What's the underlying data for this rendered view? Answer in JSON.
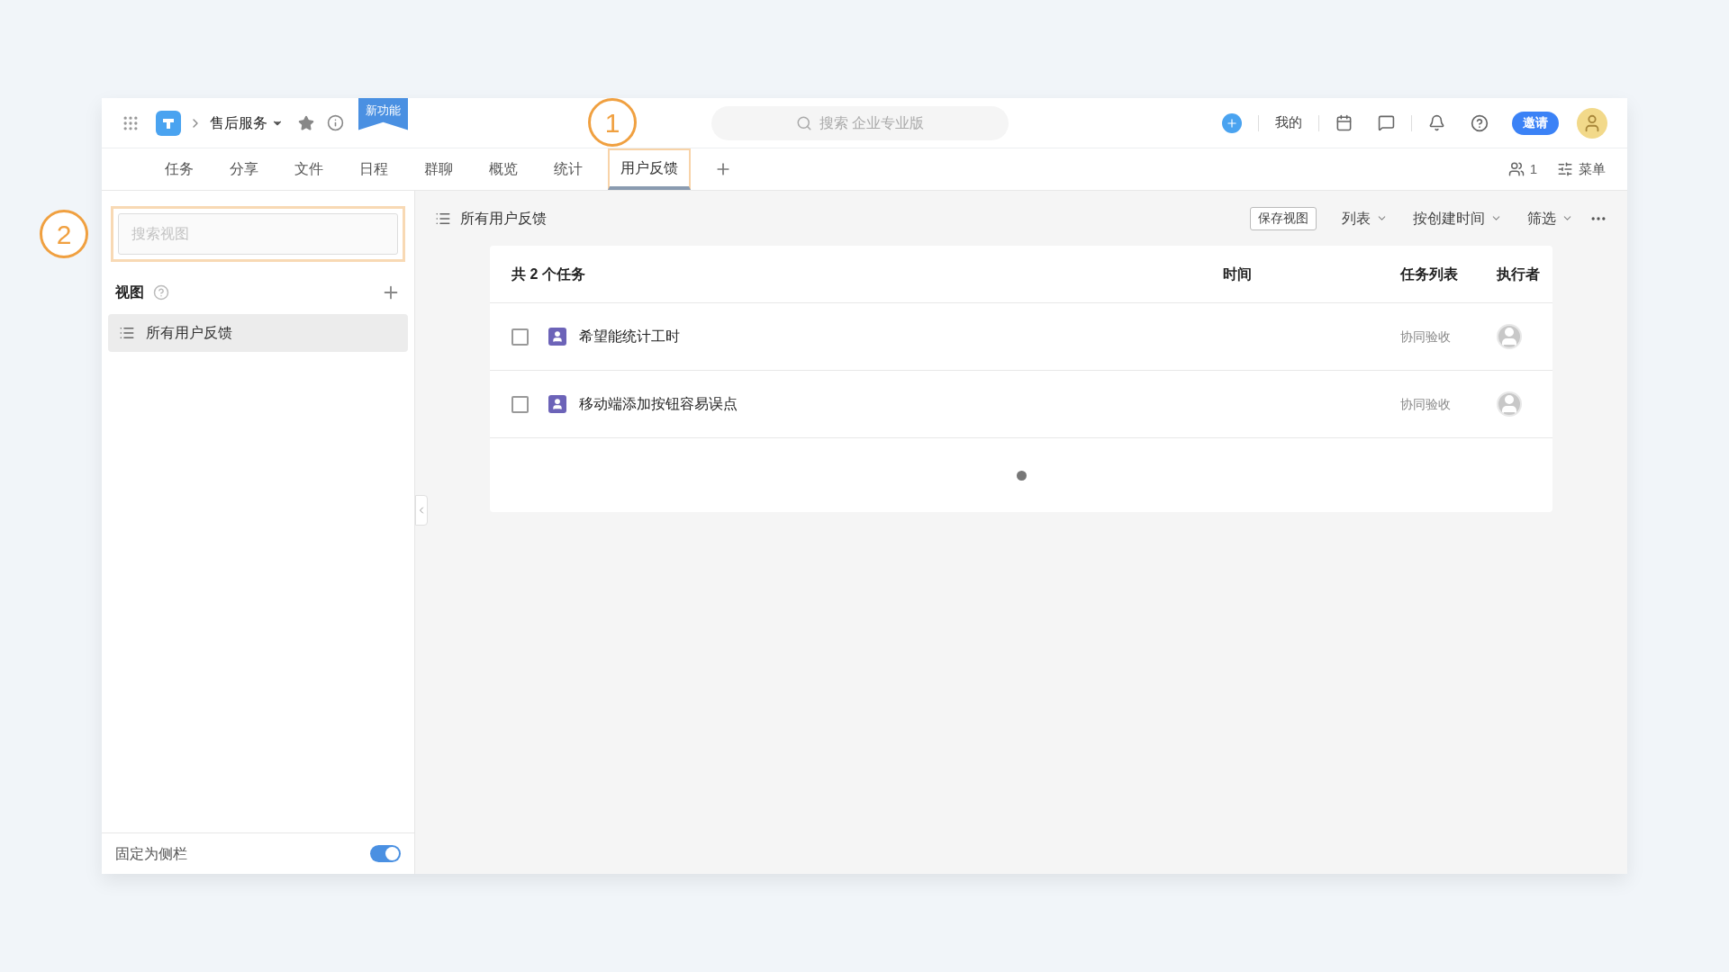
{
  "app_bar": {
    "breadcrumb": "售后服务",
    "badge": "新功能",
    "search": {
      "placeholder": "搜索 企业专业版"
    },
    "my_label": "我的",
    "invite_button": "邀请"
  },
  "annotations": [
    {
      "label": "1"
    },
    {
      "label": "2"
    }
  ],
  "tabs": [
    {
      "label": "任务",
      "selected": false
    },
    {
      "label": "分享",
      "selected": false
    },
    {
      "label": "文件",
      "selected": false
    },
    {
      "label": "日程",
      "selected": false
    },
    {
      "label": "群聊",
      "selected": false
    },
    {
      "label": "概览",
      "selected": false
    },
    {
      "label": "统计",
      "selected": false
    },
    {
      "label": "用户反馈",
      "selected": true
    }
  ],
  "members_count": "1",
  "menu_label": "菜单",
  "sidebar": {
    "search": {
      "placeholder": "搜索视图"
    },
    "views_heading": "视图",
    "views": [
      {
        "label": "所有用户反馈",
        "selected": true
      }
    ],
    "pin": {
      "label": "固定为侧栏",
      "on": true
    }
  },
  "content": {
    "title": "所有用户反馈",
    "save_view": "保存视图",
    "toolbar": [
      "列表",
      "按创建时间",
      "筛选"
    ],
    "table": {
      "columns": [
        "共 2 个任务",
        "时间",
        "任务列表",
        "执行者"
      ],
      "rows": [
        {
          "title": "希望能统计工时",
          "task_list": "协同验收",
          "checked": false
        },
        {
          "title": "移动端添加按钮容易误点",
          "task_list": "协同验收",
          "checked": false
        }
      ]
    }
  }
}
